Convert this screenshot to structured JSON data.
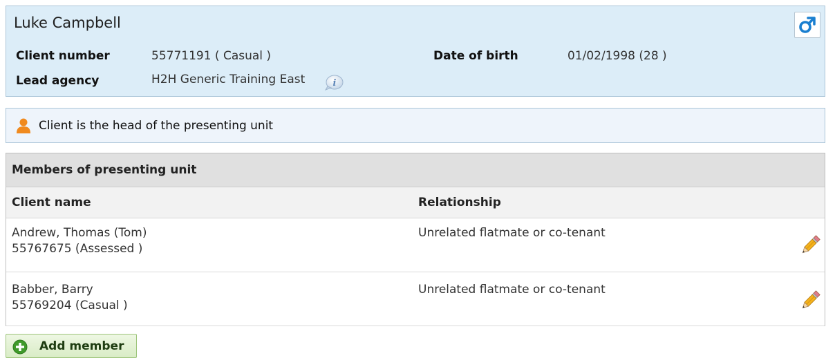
{
  "client": {
    "name": "Luke Campbell",
    "client_number_label": "Client number",
    "client_number_value": "55771191 ( Casual )",
    "lead_agency_label": "Lead agency",
    "lead_agency_value": "H2H Generic Training East",
    "dob_label": "Date of birth",
    "dob_value": "01/02/1998 (28 )",
    "gender_icon": "male-symbol-icon",
    "info_icon": "info-icon"
  },
  "head_notice": {
    "icon": "person-icon",
    "text": "Client is the head of the presenting unit"
  },
  "members": {
    "title": "Members of presenting unit",
    "columns": [
      "Client name",
      "Relationship"
    ],
    "rows": [
      {
        "name": "Andrew, Thomas (Tom)",
        "number": "55767675 (Assessed )",
        "relationship": "Unrelated flatmate or co-tenant",
        "action_icon": "pencil-edit-icon"
      },
      {
        "name": "Babber, Barry",
        "number": "55769204 (Casual )",
        "relationship": "Unrelated flatmate or co-tenant",
        "action_icon": "pencil-edit-icon"
      }
    ]
  },
  "add_member": {
    "label": "Add member",
    "icon": "plus-circle-icon"
  },
  "colors": {
    "client_panel_bg": "#dcedf8",
    "accent_blue": "#1a7fd0",
    "add_button_green": "#3f9a2a"
  }
}
